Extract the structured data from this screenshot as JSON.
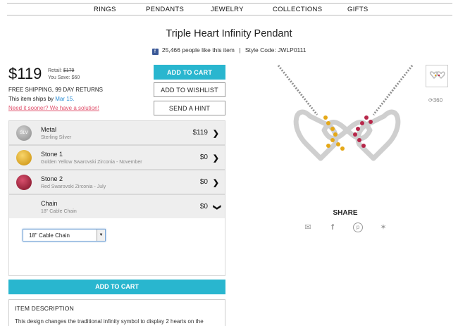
{
  "nav": [
    "RINGS",
    "PENDANTS",
    "JEWELRY",
    "COLLECTIONS",
    "GIFTS"
  ],
  "product": {
    "title": "Triple Heart Infinity Pendant",
    "likes": "25,466 people like this item",
    "separator": "|",
    "style_code": "Style Code: JWLP0111",
    "price": "$119",
    "retail_label": "Retail:",
    "retail_value": "$179",
    "you_save": "You Save: $60"
  },
  "buttons": {
    "add_to_cart": "ADD TO CART",
    "add_to_wishlist": "ADD TO WISHLIST",
    "send_hint": "SEND A HINT",
    "add_to_cart_bottom": "ADD TO CART"
  },
  "shipping": {
    "line1": "FREE SHIPPING, 99 DAY RETURNS",
    "line2_prefix": "This item ships by",
    "ship_date": "Mar 15.",
    "line3": "Need it sooner? We have a solution!"
  },
  "options": [
    {
      "name": "Metal",
      "sub": "Sterling Silver",
      "price": "$119",
      "swatch_label": "SLV",
      "color": "#9a9a9a"
    },
    {
      "name": "Stone 1",
      "sub": "Golden Yellow Swarovski Zirconia - November",
      "price": "$0",
      "color": "#e5a817"
    },
    {
      "name": "Stone 2",
      "sub": "Red Swarovski Zirconia - July",
      "price": "$0",
      "color": "#a81f3a"
    },
    {
      "name": "Chain",
      "sub": "18\" Cable Chain",
      "price": "$0"
    }
  ],
  "chain_select": {
    "value": "18\" Cable Chain"
  },
  "description": {
    "heading": "ITEM DESCRIPTION",
    "text": "This design changes the traditional infinity symbol to display 2 hearts on the"
  },
  "share": {
    "label": "SHARE",
    "icons": [
      "mail-icon",
      "facebook-icon",
      "pinterest-icon",
      "twitter-icon"
    ]
  },
  "view360": "360"
}
